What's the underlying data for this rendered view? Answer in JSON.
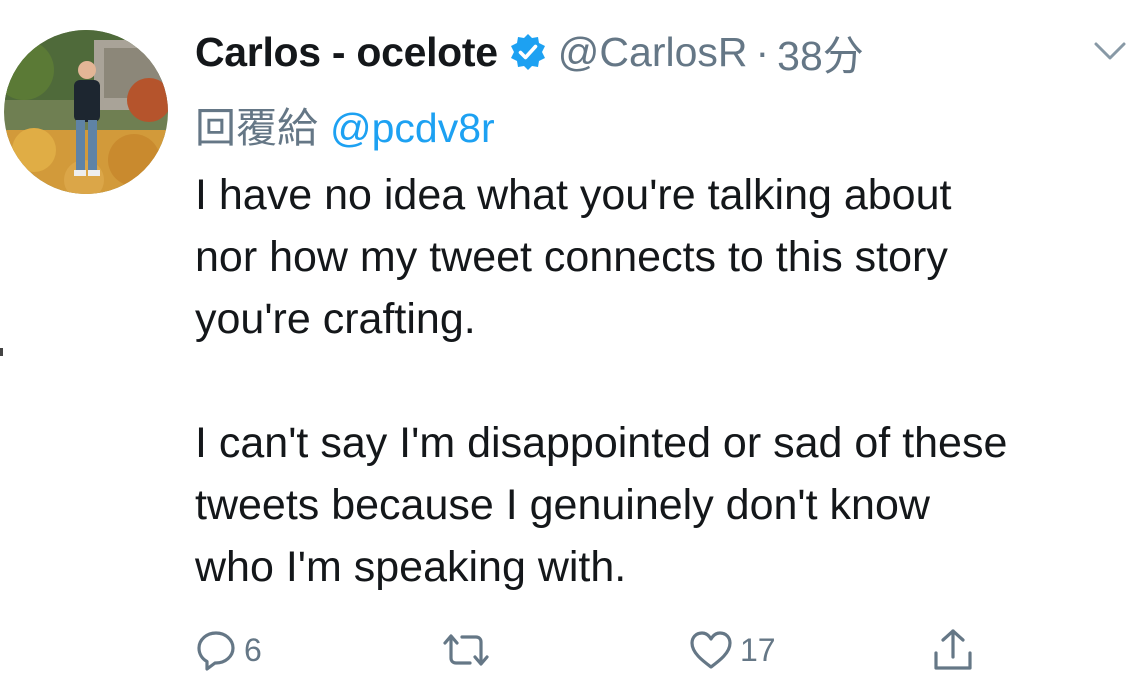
{
  "tweet": {
    "display_name": "Carlos - ocelote",
    "verified": true,
    "handle": "@CarlosR",
    "separator": "·",
    "time": "38分",
    "reply_label": "回覆給",
    "reply_handle": "@pcdv8r",
    "paragraphs": [
      "I have no idea what you're talking about\nnor how my tweet connects to this story\nyou're crafting.",
      "I can't say I'm disappointed or sad of these\ntweets because I genuinely don't know\nwho I'm speaking with."
    ]
  },
  "actions": {
    "reply_count": "6",
    "retweet_count": "",
    "like_count": "17"
  },
  "icons": {
    "verified": "verified-badge-icon",
    "menu": "chevron-down-icon",
    "reply": "reply-icon",
    "retweet": "retweet-icon",
    "like": "heart-icon",
    "share": "share-icon"
  },
  "colors": {
    "text": "#14171a",
    "muted": "#657786",
    "accent": "#1da1f2"
  }
}
